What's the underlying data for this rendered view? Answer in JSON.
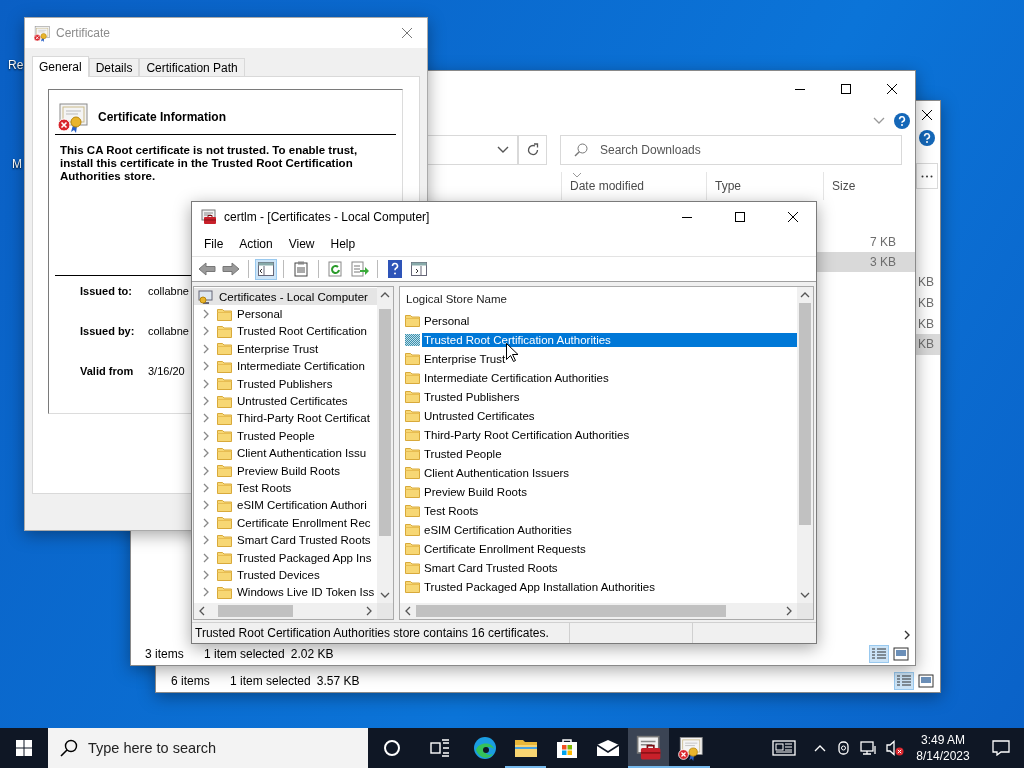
{
  "desktop": {
    "icons": [
      {
        "label": "Re"
      },
      {
        "label": "M"
      }
    ]
  },
  "explorer_back": {
    "rows": [
      {
        "size": "KB",
        "selected": false
      },
      {
        "size": "KB",
        "selected": false
      },
      {
        "size": "KB",
        "selected": false
      },
      {
        "size": "KB",
        "selected": true
      }
    ],
    "status_bar": {
      "item_count": "6 items",
      "selection": "1 item selected",
      "selection_size": "3.57 KB"
    }
  },
  "explorer_front": {
    "search": {
      "placeholder": "Search Downloads"
    },
    "columns": [
      "Date modified",
      "Type",
      "Size"
    ],
    "rows": [
      {
        "size": "7 KB",
        "selected": false
      },
      {
        "size": "3 KB",
        "selected": true
      }
    ],
    "status_bar": {
      "item_count": "3 items",
      "selection": "1 item selected",
      "selection_size": "2.02 KB"
    }
  },
  "certificate_dialog": {
    "title": "Certificate",
    "tabs": [
      {
        "label": "General",
        "selected": true
      },
      {
        "label": "Details",
        "selected": false
      },
      {
        "label": "Certification Path",
        "selected": false
      }
    ],
    "heading": "Certificate Information",
    "message": "This CA Root certificate is not trusted. To enable trust, install this certificate in the Trusted Root Certification Authorities store.",
    "fields": [
      {
        "label": "Issued to:",
        "value": "collabne"
      },
      {
        "label": "Issued by:",
        "value": "collabne"
      },
      {
        "label": "Valid from",
        "value": "3/16/20"
      }
    ]
  },
  "certlm": {
    "title": "certlm - [Certificates - Local Computer]",
    "menu": [
      "File",
      "Action",
      "View",
      "Help"
    ],
    "tree": [
      {
        "label": "Certificates - Local Computer",
        "selected": true,
        "children": [
          {
            "label": "Personal",
            "expanded": false,
            "selected": false
          },
          {
            "label": "Trusted Root Certification",
            "expanded": false,
            "selected": false
          },
          {
            "label": "Enterprise Trust",
            "expanded": false,
            "selected": false
          },
          {
            "label": "Intermediate Certification",
            "expanded": false,
            "selected": false
          },
          {
            "label": "Trusted Publishers",
            "expanded": false,
            "selected": false
          },
          {
            "label": "Untrusted Certificates",
            "expanded": false,
            "selected": false
          },
          {
            "label": "Third-Party Root Certificat",
            "expanded": false,
            "selected": false
          },
          {
            "label": "Trusted People",
            "expanded": false,
            "selected": false
          },
          {
            "label": "Client Authentication Issu",
            "expanded": false,
            "selected": false
          },
          {
            "label": "Preview Build Roots",
            "expanded": false,
            "selected": false
          },
          {
            "label": "Test Roots",
            "expanded": false,
            "selected": false
          },
          {
            "label": "eSIM Certification Authori",
            "expanded": false,
            "selected": false
          },
          {
            "label": "Certificate Enrollment Rec",
            "expanded": false,
            "selected": false
          },
          {
            "label": "Smart Card Trusted Roots",
            "expanded": false,
            "selected": false
          },
          {
            "label": "Trusted Packaged App Ins",
            "expanded": false,
            "selected": false
          },
          {
            "label": "Trusted Devices",
            "expanded": false,
            "selected": false
          },
          {
            "label": "Windows Live ID Token Iss",
            "expanded": false,
            "selected": false
          }
        ]
      }
    ],
    "list": {
      "column": "Logical Store Name",
      "rows": [
        {
          "label": "Personal",
          "selected": false
        },
        {
          "label": "Trusted Root Certification Authorities",
          "selected": true
        },
        {
          "label": "Enterprise Trust",
          "selected": false
        },
        {
          "label": "Intermediate Certification Authorities",
          "selected": false
        },
        {
          "label": "Trusted Publishers",
          "selected": false
        },
        {
          "label": "Untrusted Certificates",
          "selected": false
        },
        {
          "label": "Third-Party Root Certification Authorities",
          "selected": false
        },
        {
          "label": "Trusted People",
          "selected": false
        },
        {
          "label": "Client Authentication Issuers",
          "selected": false
        },
        {
          "label": "Preview Build Roots",
          "selected": false
        },
        {
          "label": "Test Roots",
          "selected": false
        },
        {
          "label": "eSIM Certification Authorities",
          "selected": false
        },
        {
          "label": "Certificate Enrollment Requests",
          "selected": false
        },
        {
          "label": "Smart Card Trusted Roots",
          "selected": false
        },
        {
          "label": "Trusted Packaged App Installation Authorities",
          "selected": false
        }
      ]
    },
    "status_bar": "Trusted Root Certification Authorities store contains 16 certificates."
  },
  "taskbar": {
    "search": {
      "placeholder": "Type here to search"
    },
    "apps": [
      {
        "kind": "browser",
        "running": false,
        "active": false
      },
      {
        "kind": "folder",
        "running": true,
        "active": false
      },
      {
        "kind": "store",
        "running": false,
        "active": false
      },
      {
        "kind": "mail",
        "running": false,
        "active": false
      },
      {
        "kind": "toolbox",
        "running": true,
        "active": true
      },
      {
        "kind": "certificate",
        "running": true,
        "active": false
      }
    ],
    "clock": {
      "time": "3:49 AM",
      "date": "8/14/2023"
    }
  }
}
